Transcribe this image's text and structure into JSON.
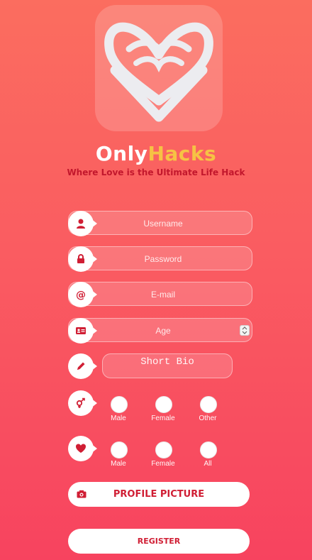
{
  "brand": {
    "name_part1": "Only",
    "name_part2": "Hacks",
    "tagline": "Where Love is the Ultimate Life Hack"
  },
  "colors": {
    "accent": "#d01e34",
    "brand_yellow": "#f6c244",
    "background_top": "#fb6d5f",
    "background_bottom": "#f7435f"
  },
  "form": {
    "username": {
      "placeholder": "Username",
      "icon": "user-icon"
    },
    "password": {
      "placeholder": "Password",
      "icon": "lock-icon"
    },
    "email": {
      "placeholder": "E-mail",
      "icon": "at-icon"
    },
    "age": {
      "placeholder": "Age",
      "icon": "id-card-icon"
    },
    "bio": {
      "placeholder": "Short Bio",
      "icon": "pencil-icon"
    },
    "gender": {
      "icon": "gender-icon",
      "options": [
        "Male",
        "Female",
        "Other"
      ]
    },
    "interest": {
      "icon": "heart-icon",
      "options": [
        "Male",
        "Female",
        "All"
      ]
    },
    "profile_picture": {
      "label": "PROFILE PICTURE",
      "icon": "camera-icon"
    },
    "register": {
      "label": "REGISTER"
    }
  }
}
